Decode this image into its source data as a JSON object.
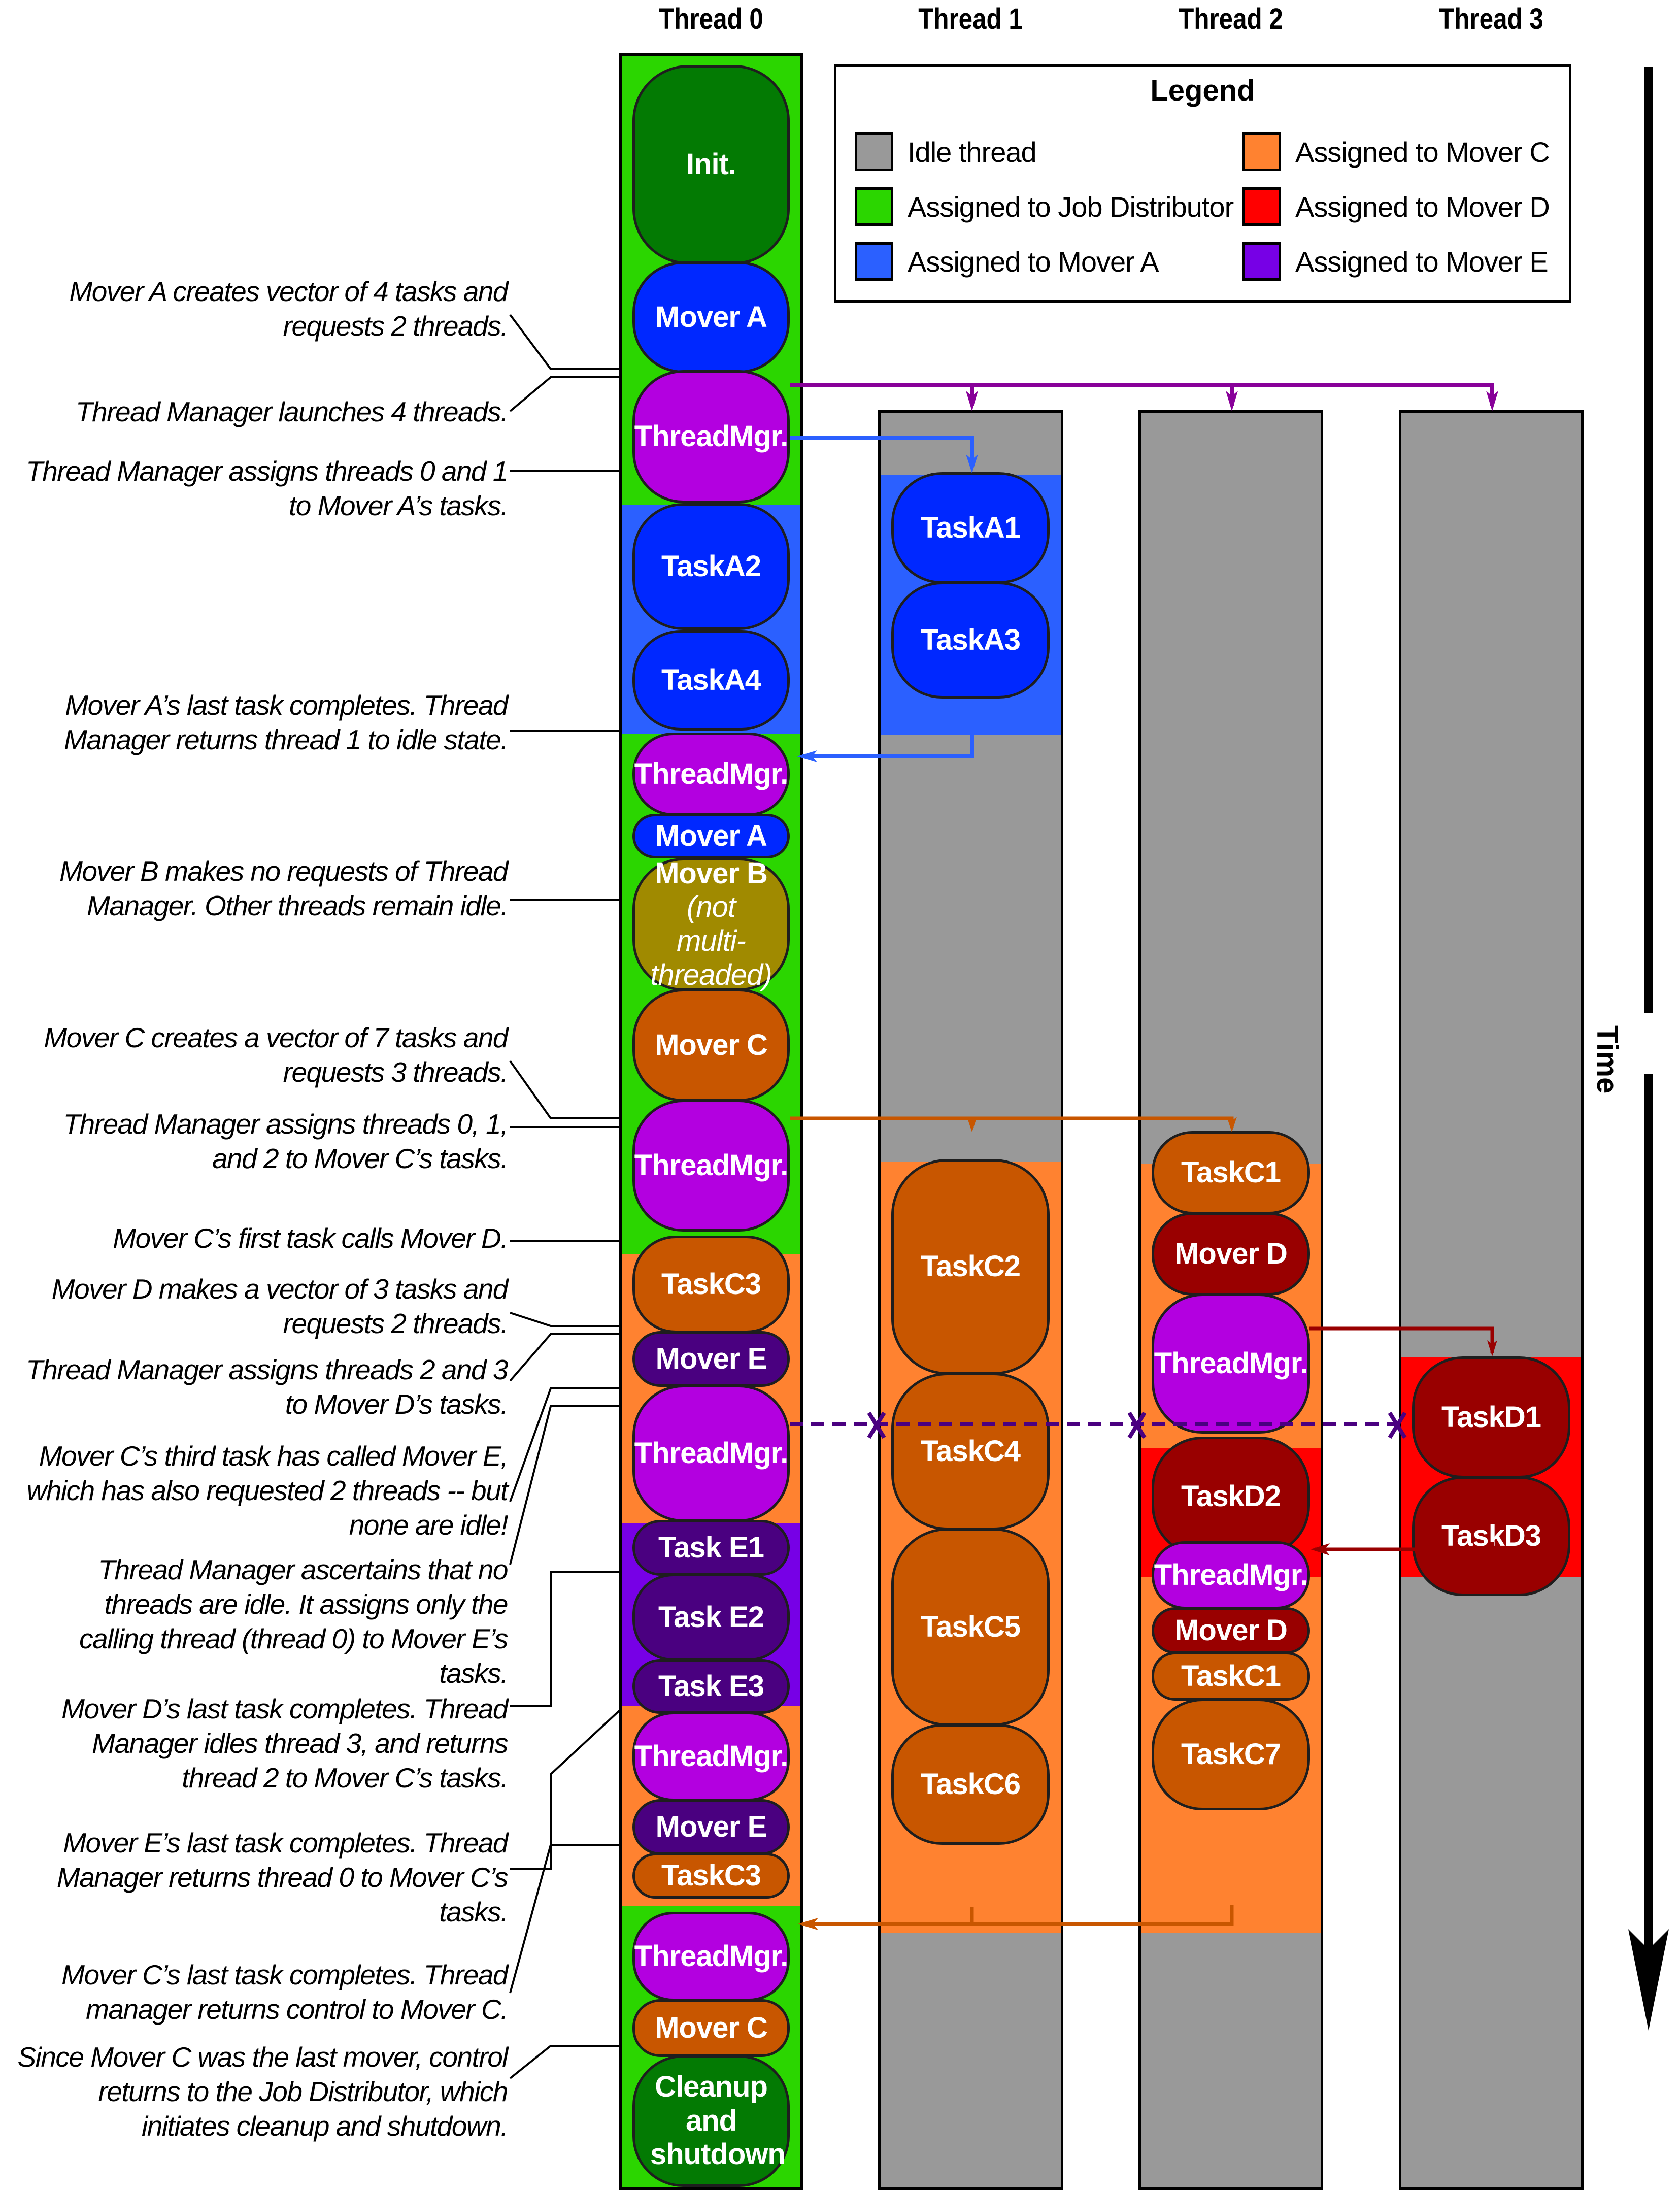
{
  "headers": [
    "Thread 0",
    "Thread 1",
    "Thread 2",
    "Thread 3"
  ],
  "legend": {
    "title": "Legend",
    "items": [
      {
        "label": "Idle thread",
        "color": "#999999"
      },
      {
        "label": "Assigned to Job Distributor",
        "color": "#2bd600"
      },
      {
        "label": "Assigned to Mover A",
        "color": "#2b60ff"
      },
      {
        "label": "Assigned to Mover C",
        "color": "#ff8230"
      },
      {
        "label": "Assigned to Mover D",
        "color": "#ff0000"
      },
      {
        "label": "Assigned to Mover E",
        "color": "#7700e6"
      }
    ]
  },
  "colors": {
    "idle": "#999999",
    "job_distributor": "#2bd600",
    "mover_a_bg": "#2b60ff",
    "mover_c_bg": "#ff8230",
    "mover_d_bg": "#ff0000",
    "mover_e_bg": "#7700e6",
    "init_pill": "#037a03",
    "mover_a_pill": "#0028ff",
    "thread_mgr_pill": "#b300e0",
    "mover_b_pill": "#a08a00",
    "mover_c_pill": "#c85600",
    "mover_d_pill": "#990000",
    "mover_e_pill": "#4a0080"
  },
  "time_label": "Time",
  "thread0": {
    "pills": [
      {
        "label": "Init.",
        "kind": "init"
      },
      {
        "label": "Mover A",
        "kind": "mover_a"
      },
      {
        "label": "ThreadMgr.",
        "kind": "thread_mgr"
      },
      {
        "label": "TaskA2",
        "kind": "mover_a"
      },
      {
        "label": "TaskA4",
        "kind": "mover_a"
      },
      {
        "label": "ThreadMgr.",
        "kind": "thread_mgr"
      },
      {
        "label": "Mover A",
        "kind": "mover_a"
      },
      {
        "label": "Mover B",
        "sub": "(not multi-threaded)",
        "kind": "mover_b"
      },
      {
        "label": "Mover C",
        "kind": "mover_c"
      },
      {
        "label": "ThreadMgr.",
        "kind": "thread_mgr"
      },
      {
        "label": "TaskC3",
        "kind": "mover_c"
      },
      {
        "label": "Mover E",
        "kind": "mover_e"
      },
      {
        "label": "ThreadMgr.",
        "kind": "thread_mgr"
      },
      {
        "label": "Task E1",
        "kind": "mover_e"
      },
      {
        "label": "Task E2",
        "kind": "mover_e"
      },
      {
        "label": "Task E3",
        "kind": "mover_e"
      },
      {
        "label": "ThreadMgr.",
        "kind": "thread_mgr"
      },
      {
        "label": "Mover E",
        "kind": "mover_e"
      },
      {
        "label": "TaskC3",
        "kind": "mover_c"
      },
      {
        "label": "ThreadMgr.",
        "kind": "thread_mgr"
      },
      {
        "label": "Mover C",
        "kind": "mover_c"
      },
      {
        "label": "Cleanup and shutdown",
        "kind": "init"
      }
    ]
  },
  "thread1": {
    "pills": [
      {
        "label": "TaskA1",
        "kind": "mover_a"
      },
      {
        "label": "TaskA3",
        "kind": "mover_a"
      },
      {
        "label": "TaskC2",
        "kind": "mover_c"
      },
      {
        "label": "TaskC4",
        "kind": "mover_c"
      },
      {
        "label": "TaskC5",
        "kind": "mover_c"
      },
      {
        "label": "TaskC6",
        "kind": "mover_c"
      }
    ]
  },
  "thread2": {
    "pills": [
      {
        "label": "TaskC1",
        "kind": "mover_c"
      },
      {
        "label": "Mover D",
        "kind": "mover_d"
      },
      {
        "label": "ThreadMgr.",
        "kind": "thread_mgr"
      },
      {
        "label": "TaskD2",
        "kind": "mover_d"
      },
      {
        "label": "ThreadMgr.",
        "kind": "thread_mgr"
      },
      {
        "label": "Mover D",
        "kind": "mover_d"
      },
      {
        "label": "TaskC1",
        "kind": "mover_c"
      },
      {
        "label": "TaskC7",
        "kind": "mover_c"
      }
    ]
  },
  "thread3": {
    "pills": [
      {
        "label": "TaskD1",
        "kind": "mover_d"
      },
      {
        "label": "TaskD3",
        "kind": "mover_d"
      }
    ]
  },
  "notes": [
    "Mover A creates vector of 4 tasks and\nrequests 2 threads.",
    "Thread Manager launches 4 threads.",
    "Thread Manager assigns threads 0 and 1\nto Mover A’s tasks.",
    "Mover A’s last task completes.  Thread\nManager returns thread 1 to idle state.",
    "Mover B makes no requests of Thread\nManager.  Other threads remain idle.",
    "Mover C creates a vector of 7 tasks and\nrequests 3 threads.",
    "Thread Manager assigns threads 0, 1,\nand 2 to Mover C’s tasks.",
    "Mover C’s first task calls Mover D.",
    "Mover D makes a vector of 3 tasks and\nrequests 2 threads.",
    "Thread Manager assigns threads 2 and 3\nto Mover D’s tasks.",
    "Mover C’s third task has called Mover E,\nwhich has also requested 2 threads -- but\nnone are idle!",
    "Thread Manager ascertains that no\nthreads are idle.  It assigns only the\ncalling thread (thread 0) to Mover E’s\ntasks.",
    "Mover D’s last task completes.  Thread\nManager idles thread 3, and returns\nthread 2 to Mover C’s tasks.",
    "Mover E’s last task completes.  Thread\nManager returns thread 0 to Mover C’s\ntasks.",
    "Mover C’s last task completes.  Thread\nmanager returns control to Mover C.",
    "Since Mover C was the last mover, control\nreturns to the Job Distributor, which\ninitiates cleanup and shutdown."
  ]
}
